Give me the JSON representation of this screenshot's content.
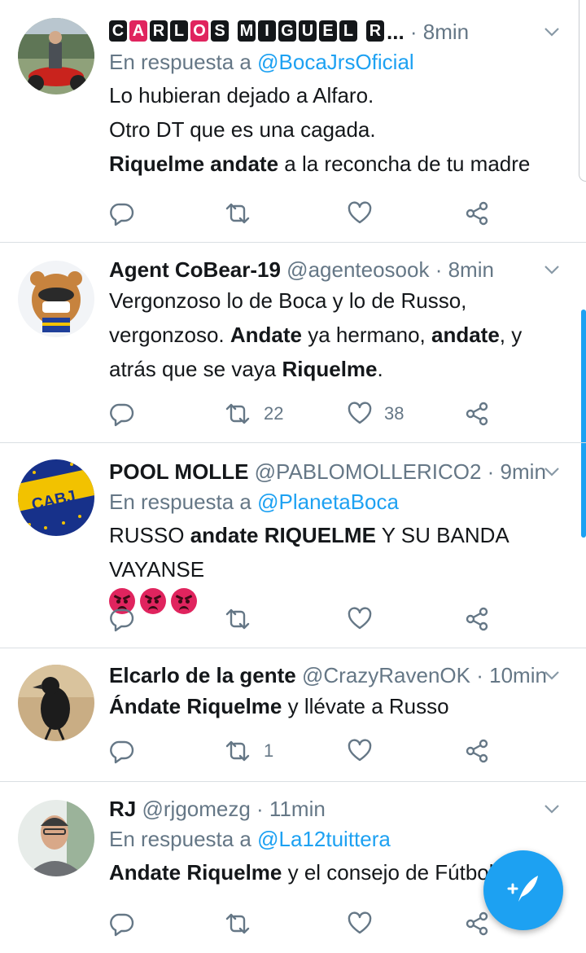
{
  "tweets": [
    {
      "name_letters": [
        "C",
        "A",
        "R",
        "L",
        "O",
        "S",
        "M",
        "I",
        "G",
        "U",
        "E",
        "L",
        "R"
      ],
      "name_suffix": "...",
      "handle": "",
      "dot": " · ",
      "time": "8min",
      "reply_prefix": "En respuesta a ",
      "reply_to": "@BocaJrsOficial",
      "lines": [
        [
          {
            "t": "Lo hubieran dejado a Alfaro.",
            "b": false
          }
        ],
        [
          {
            "t": "Otro DT que es una cagada.",
            "b": false
          }
        ],
        [
          {
            "t": "Riquelme andate",
            "b": true
          },
          {
            "t": " a la reconcha de tu madre",
            "b": false
          }
        ]
      ],
      "retweets": "",
      "likes": ""
    },
    {
      "name": "Agent CoBear-19",
      "handle": "@agenteosook",
      "dot": " · ",
      "time": "8min",
      "lines": [
        [
          {
            "t": "Vergonzoso lo de Boca y lo de Russo,",
            "b": false
          }
        ],
        [
          {
            "t": "vergonzoso. ",
            "b": false
          },
          {
            "t": "Andate",
            "b": true
          },
          {
            "t": " ya hermano, ",
            "b": false
          },
          {
            "t": "andate",
            "b": true
          },
          {
            "t": ", y",
            "b": false
          }
        ],
        [
          {
            "t": "atrás que se vaya ",
            "b": false
          },
          {
            "t": "Riquelme",
            "b": true
          },
          {
            "t": ".",
            "b": false
          }
        ]
      ],
      "retweets": "22",
      "likes": "38"
    },
    {
      "name": "POOL MOLLE",
      "handle": "@PABLOMOLLERICO2",
      "dot": " · ",
      "time": "9min",
      "reply_prefix": "En respuesta a ",
      "reply_to": "@PlanetaBoca",
      "lines": [
        [
          {
            "t": "RUSSO ",
            "b": false
          },
          {
            "t": "andate RIQUELME",
            "b": true
          },
          {
            "t": " Y SU BANDA VAYANSE",
            "b": false
          }
        ]
      ],
      "emoji_count_label": "angry-face x3",
      "retweets": "",
      "likes": ""
    },
    {
      "name": "Elcarlo de la gente",
      "handle": "@CrazyRavenOK",
      "dot": " · ",
      "time": "10min",
      "lines": [
        [
          {
            "t": "Ándate Riquelme",
            "b": true
          },
          {
            "t": " y llévate a Russo",
            "b": false
          }
        ]
      ],
      "retweets": "1",
      "likes": ""
    },
    {
      "name": "RJ",
      "handle": "@rjgomezg",
      "dot": " · ",
      "time": "11min",
      "reply_prefix": "En respuesta a ",
      "reply_to": "@La12tuittera",
      "lines": [
        [
          {
            "t": "Andate Riquelme",
            "b": true
          },
          {
            "t": " y el consejo de Fútbol",
            "b": false
          }
        ]
      ],
      "retweets": "",
      "likes": ""
    }
  ],
  "colors": {
    "accent": "#1da1f2",
    "text": "#14171a",
    "muted": "#657786",
    "divider": "#dadfe3",
    "angry": "#e0245e"
  },
  "icons": [
    "reply-icon",
    "retweet-icon",
    "like-icon",
    "share-icon",
    "chevron-down-icon",
    "compose-tweet-icon"
  ]
}
